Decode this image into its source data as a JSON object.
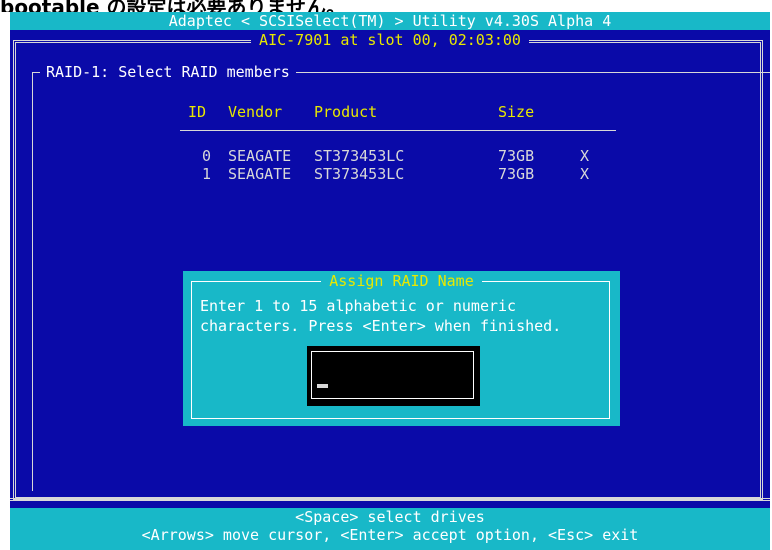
{
  "top_strip": {
    "text": "bootable の設定は必要ありません。"
  },
  "title_bar": {
    "text": "Adaptec < SCSISelect(TM) > Utility v4.30S Alpha 4"
  },
  "adapter": {
    "text": "AIC-7901    at slot 00, 02:03:00"
  },
  "section": {
    "title": "RAID-1: Select RAID members"
  },
  "table": {
    "headers": {
      "id": "ID",
      "vendor": "Vendor",
      "product": "Product",
      "size": "Size"
    },
    "rows": [
      {
        "id": "0",
        "vendor": "SEAGATE",
        "product": "ST373453LC",
        "size": "73GB",
        "mark": "X"
      },
      {
        "id": "1",
        "vendor": "SEAGATE",
        "product": "ST373453LC",
        "size": "73GB",
        "mark": "X"
      }
    ]
  },
  "dialog": {
    "title": "Assign RAID Name",
    "line1": "Enter 1 to 15 alphabetic or numeric",
    "line2": "characters. Press <Enter> when finished.",
    "input_value": ""
  },
  "status": {
    "line1": "<Space> select drives",
    "line2": "<Arrows> move cursor, <Enter> accept option, <Esc> exit"
  },
  "colors": {
    "background_blue": "#0a0aa8",
    "cyan": "#18b8c8",
    "highlight_yellow": "#e8e800",
    "text_grey": "#d8d8d8"
  }
}
